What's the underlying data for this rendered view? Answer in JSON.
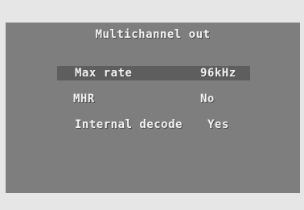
{
  "menu": {
    "title": "Multichannel out",
    "items": [
      {
        "label": "Max rate",
        "value": "96kHz",
        "selected": true
      },
      {
        "label": "MHR",
        "value": "No",
        "selected": false
      },
      {
        "label": "Internal decode",
        "value": "Yes",
        "selected": false
      }
    ]
  },
  "colors": {
    "screen_bg": "#7e7e7e",
    "frame_bg": "#e6e6e6",
    "highlight_bg": "#5e5e5e",
    "text": "#f2f2f2"
  }
}
